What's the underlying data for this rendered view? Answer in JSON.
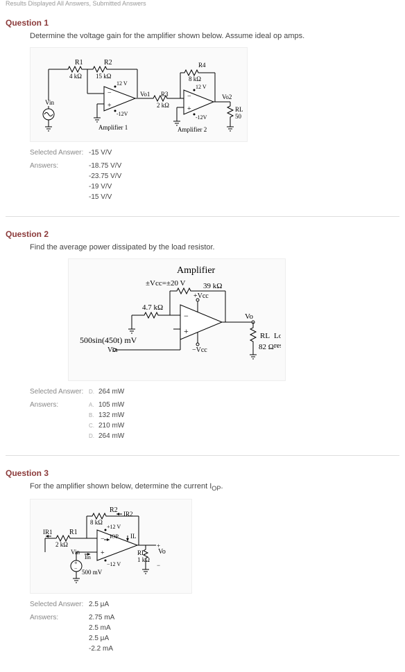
{
  "results_line": "Results Displayed All Answers, Submitted Answers",
  "q1": {
    "header": "Question 1",
    "prompt": "Determine the voltage gain for the amplifier shown below. Assume ideal op amps.",
    "labels": {
      "r1": "R1",
      "r1v": "4 kΩ",
      "r2": "R2",
      "r2v": "15 kΩ",
      "r3": "R3",
      "r3v": "2 kΩ",
      "r4": "R4",
      "r4v": "8 kΩ",
      "rl": "RL",
      "rlv": "50 Ω",
      "p12": "12 V",
      "m12": "-12V",
      "vin": "Vin",
      "vo1": "Vo1",
      "vo2": "Vo2",
      "amp1": "Amplifier 1",
      "amp2": "Amplifier 2"
    },
    "selected_label": "Selected Answer:",
    "selected": "-15 V/V",
    "answers_label": "Answers:",
    "answers": [
      "-18.75 V/V",
      "-23.75 V/V",
      "-19 V/V",
      "-15 V/V"
    ]
  },
  "q2": {
    "header": "Question 2",
    "prompt": "Find the average power dissipated by the load resistor.",
    "labels": {
      "title": "Amplifier",
      "vcc": "±Vcc=±20 V",
      "r39": "39 kΩ",
      "r47": "4.7 kΩ",
      "pvcc": "+Vcc",
      "mvcc": "−Vcc",
      "vo": "Vo",
      "rl": "RL",
      "rlv": "82 Ω",
      "load": "Load",
      "resistor": "resistor",
      "vin": "500sin(450t) mV",
      "vinlbl": "Vin"
    },
    "selected_label": "Selected Answer:",
    "selected": "264 mW",
    "answers_label": "Answers:",
    "marks": [
      "A.",
      "B.",
      "C.",
      "D."
    ],
    "answers": [
      "105 mW",
      "132 mW",
      "210 mW",
      "264 mW"
    ]
  },
  "q3": {
    "header": "Question 3",
    "prompt_pre": "For the amplifier shown below, determine the current I",
    "prompt_sub": "OP",
    "prompt_post": ".",
    "labels": {
      "r1": "R1",
      "r1v": "2 kΩ",
      "r2": "R2",
      "r2v": "8 kΩ",
      "rl": "RL",
      "rlv": "1 kΩ",
      "ir1": "IR1",
      "ir2": "IR2",
      "iop": "IOP",
      "il": "IL",
      "p12": "+12 V",
      "m12": "−12 V",
      "vin": "Vin",
      "iin": "Iin",
      "src": "500 mV",
      "vo": "Vo"
    },
    "selected_label": "Selected Answer:",
    "selected": "2.5 μA",
    "answers_label": "Answers:",
    "answers": [
      "2.75 mA",
      "2.5 mA",
      "2.5 μA",
      "-2.2 mA"
    ]
  }
}
